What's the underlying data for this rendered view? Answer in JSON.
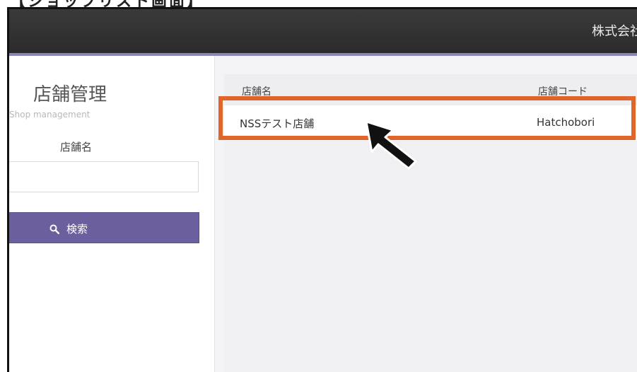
{
  "caption": "【ショップリスト画面】",
  "header": {
    "title": "株式会社"
  },
  "sidebar": {
    "title": "店舗管理",
    "subtitle": "Shop management",
    "field_label": "店舗名",
    "search_input": {
      "value": "",
      "placeholder": ""
    },
    "search_button_label": "検索"
  },
  "table": {
    "columns": [
      "店舗名",
      "店舗コード"
    ],
    "rows": [
      {
        "name": "NSSテスト店舗",
        "code": "Hatchobori"
      }
    ]
  },
  "annotations": {
    "highlight_color": "#e0652a",
    "pointer": "arrow-pointer-icon"
  },
  "colors": {
    "header_bg": "#2f2f2f",
    "header_accent": "#8a86b8",
    "button_bg": "#6c5f9d"
  }
}
